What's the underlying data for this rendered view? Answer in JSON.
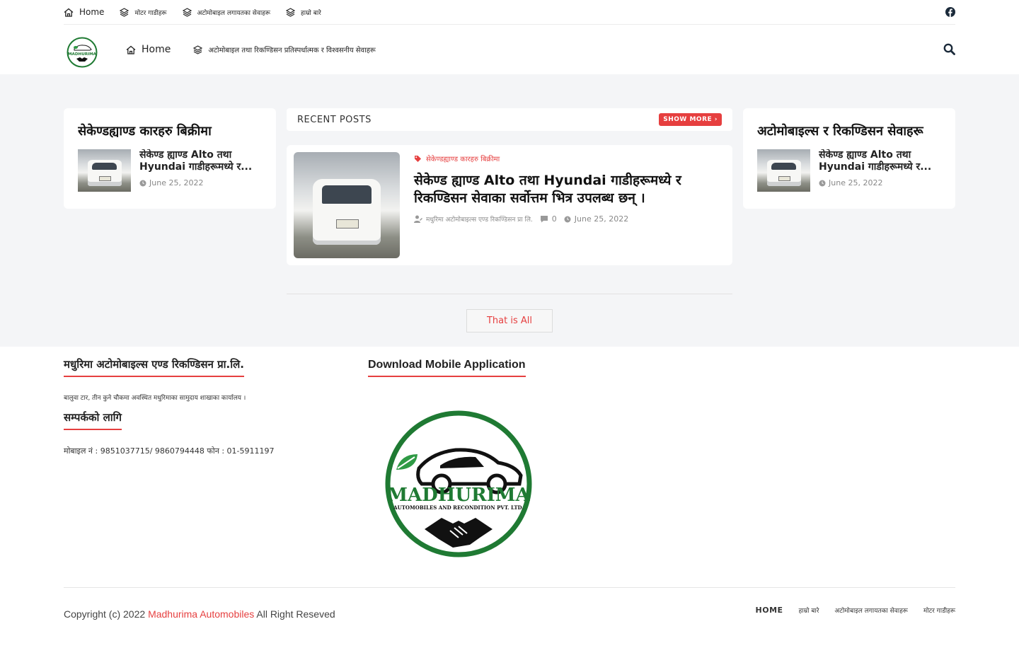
{
  "topbar": {
    "items": [
      {
        "label": "Home",
        "icon": "home-icon"
      },
      {
        "label": "मोटर गाडीहरू",
        "icon": "layers-icon"
      },
      {
        "label": "अटोमोबाइल लगायतका सेवाहरू",
        "icon": "layers-icon"
      },
      {
        "label": "हाम्रो बारे",
        "icon": "layers-icon"
      }
    ],
    "social_icon": "facebook-icon"
  },
  "header": {
    "logo_alt": "MADHURIMA",
    "nav": [
      {
        "label": "Home",
        "icon": "home-icon"
      },
      {
        "label": "अटोमोबाइल तथा रिकण्डिसन प्रतिस्पर्धात्मक र विश्वसनीय सेवाहरू",
        "icon": "layers-icon"
      }
    ],
    "search_icon": "search-icon"
  },
  "left_widget": {
    "title": "सेकेण्डह्याण्ड कारहरु बिक्रीमा",
    "post_title": "सेकेण्ड ह्याण्ड Alto तथा Hyundai गाडीहरूमध्ये र...",
    "post_date": "June 25, 2022"
  },
  "recent": {
    "heading": "RECENT POSTS",
    "show_more": "SHOW MORE ›",
    "post": {
      "category": "सेकेण्डह्याण्ड कारहरु बिक्रीमा",
      "title": "सेकेण्ड ह्याण्ड Alto तथा Hyundai गाडीहरूमध्ये र रिकण्डिसन सेवाका सर्वोत्तम भित्र उपलब्ध छन् ।",
      "author": "मधुरिमा अटोमोबाइल्स एण्ड रिकण्डिसन प्रा लि.",
      "comments": "0",
      "date": "June 25, 2022"
    },
    "that_is_all": "That is All"
  },
  "right_widget": {
    "title": "अटोमोबाइल्स र रिकण्डिसन सेवाहरू",
    "post_title": "सेकेण्ड ह्याण्ड Alto तथा Hyundai गाडीहरूमध्ये र...",
    "post_date": "June 25, 2022"
  },
  "footer": {
    "company_title": "मधुरिमा अटोमोबाइल्स एण्ड रिकण्डिसन प्रा.लि.",
    "description": "बालुवा टार, तीन कुने चौकमा अवस्थित मधुरिमाका सामुदाय शाखाका कार्यालय ।",
    "contact_title": "सम्पर्कको लागि",
    "contact": "मोबाइल नं : 9851037715/ 9860794448 फोन : 01-5911197",
    "app_title": "Download Mobile Application",
    "app_logo_main": "MADHURIMA",
    "app_logo_sub": "AUTOMOBILES AND RECONDITION PVT. LTD.",
    "copyright_prefix": "Copyright (c) 2022",
    "copyright_brand": "Madhurima Automobiles",
    "copyright_suffix": "All Right Reseved",
    "nav": [
      "HOME",
      "हाम्रो बारे",
      "अटोमोबाइल लगायतका सेवाहरू",
      "मोटर गाडीहरू"
    ]
  },
  "colors": {
    "accent": "#e63f3f",
    "logo_green": "#1f7a33",
    "content_bg": "#f4f5f7"
  }
}
